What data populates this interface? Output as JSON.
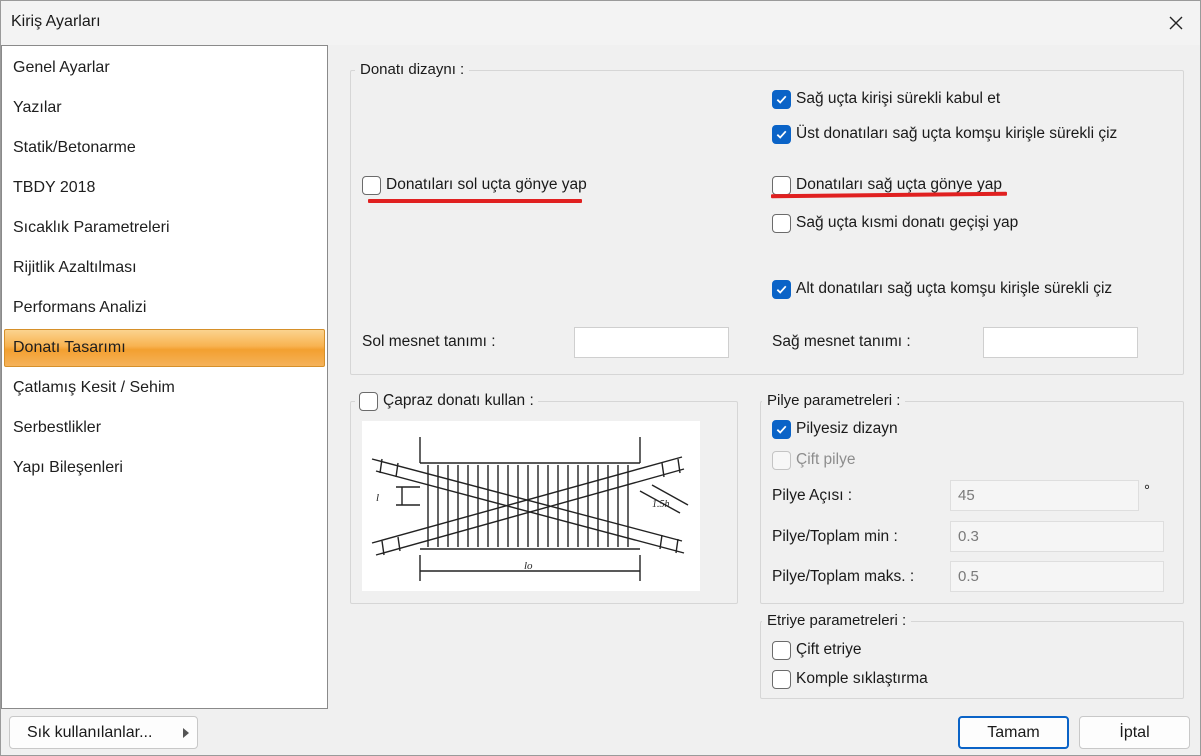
{
  "window": {
    "title": "Kiriş Ayarları"
  },
  "sidebar": {
    "items": [
      {
        "label": "Genel Ayarlar",
        "active": false
      },
      {
        "label": "Yazılar",
        "active": false
      },
      {
        "label": "Statik/Betonarme",
        "active": false
      },
      {
        "label": "TBDY 2018",
        "active": false
      },
      {
        "label": "Sıcaklık Parametreleri",
        "active": false
      },
      {
        "label": "Rijitlik Azaltılması",
        "active": false
      },
      {
        "label": "Performans Analizi",
        "active": false
      },
      {
        "label": "Donatı Tasarımı",
        "active": true
      },
      {
        "label": "Çatlamış Kesit / Sehim",
        "active": false
      },
      {
        "label": "Serbestlikler",
        "active": false
      },
      {
        "label": "Yapı Bileşenleri",
        "active": false
      }
    ]
  },
  "donati_dizayni": {
    "title": "Donatı dizaynı :",
    "sag_surekli": {
      "label": "Sağ uçta kirişi sürekli kabul et",
      "checked": true
    },
    "ust_surekli": {
      "label": "Üst donatıları sağ uçta komşu kirişle sürekli çiz",
      "checked": true
    },
    "sol_gonye": {
      "label": "Donatıları sol uçta gönye yap",
      "checked": false
    },
    "sag_gonye": {
      "label": "Donatıları sağ uçta gönye yap",
      "checked": false
    },
    "kismi_gecis": {
      "label": "Sağ uçta kısmi donatı geçişi yap",
      "checked": false
    },
    "alt_surekli": {
      "label": "Alt donatıları sağ uçta komşu kirişle sürekli çiz",
      "checked": true
    },
    "sol_mesnet_label": "Sol mesnet tanımı :",
    "sol_mesnet_value": "",
    "sag_mesnet_label": "Sağ mesnet tanımı :",
    "sag_mesnet_value": ""
  },
  "capraz": {
    "label": "Çapraz donatı kullan :",
    "checked": false,
    "diagram_labels": {
      "dim_left": "l",
      "dim_right": "1.5h",
      "dim_bottom": "lo"
    }
  },
  "pilye": {
    "title": "Pilye parametreleri :",
    "pilyesiz": {
      "label": "Pilyesiz dizayn",
      "checked": true
    },
    "cift_pilye": {
      "label": "Çift pilye",
      "checked": false,
      "disabled": true
    },
    "aci_label": "Pilye Açısı :",
    "aci_value": "45",
    "aci_unit": "°",
    "min_label": "Pilye/Toplam min :",
    "min_value": "0.3",
    "maks_label": "Pilye/Toplam maks. :",
    "maks_value": "0.5"
  },
  "etriye": {
    "title": "Etriye parametreleri :",
    "cift_etriye": {
      "label": "Çift etriye",
      "checked": false
    },
    "komple": {
      "label": "Komple sıklaştırma",
      "checked": false
    }
  },
  "footer": {
    "favorites": "Sık kullanılanlar...",
    "ok": "Tamam",
    "cancel": "İptal"
  },
  "colors": {
    "accent": "#0a63c7",
    "active_nav": "#f8b250",
    "highlight_underline": "#e02020"
  }
}
